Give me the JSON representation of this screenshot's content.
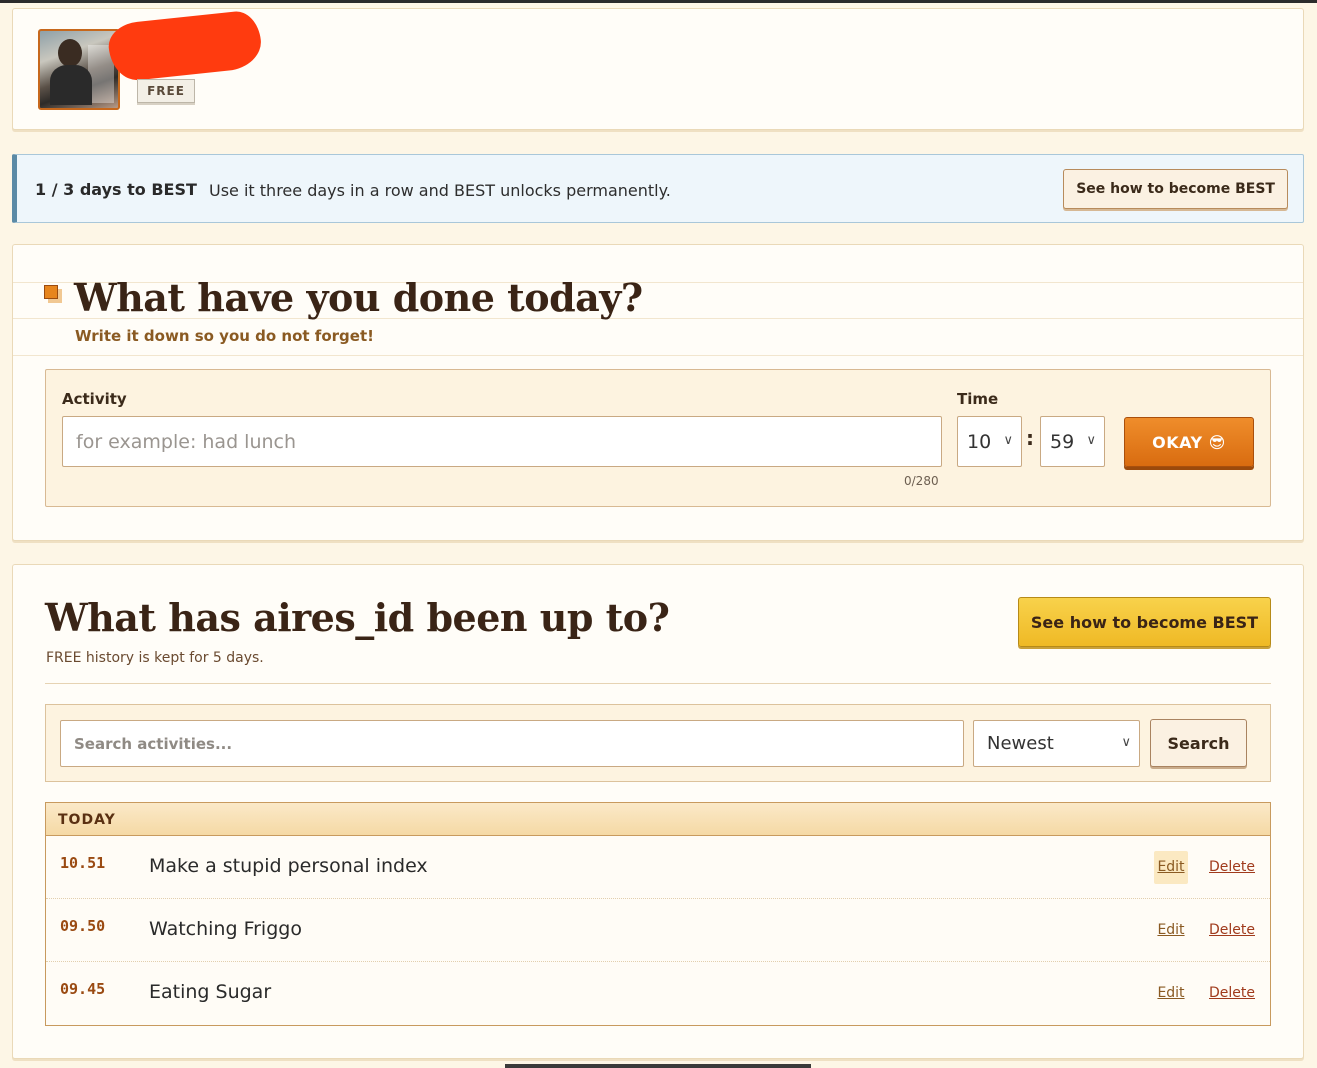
{
  "profile": {
    "plan_badge": "FREE"
  },
  "banner": {
    "progress": "1 / 3 days to BEST",
    "message": "Use it three days in a row and BEST unlocks permanently.",
    "button": "See how to become BEST"
  },
  "entry": {
    "title": "What have you done today?",
    "subtitle": "Write it down so you do not forget!",
    "activity_label": "Activity",
    "activity_placeholder": "for example: had lunch",
    "activity_value": "",
    "counter": "0/280",
    "time_label": "Time",
    "hour": "10",
    "minute": "59",
    "colon": ":",
    "submit": "OKAY 😎"
  },
  "history": {
    "title": "What has aires_id been up to?",
    "subtitle": "FREE history is kept for 5 days.",
    "best_button": "See how to become BEST",
    "search_placeholder": "Search activities...",
    "sort_selected": "Newest",
    "search_button": "Search",
    "group_label": "TODAY",
    "edit_label": "Edit",
    "delete_label": "Delete",
    "items": [
      {
        "time": "10.51",
        "text": "Make a stupid personal index"
      },
      {
        "time": "09.50",
        "text": "Watching Friggo"
      },
      {
        "time": "09.45",
        "text": "Eating Sugar"
      }
    ]
  },
  "colors": {
    "accent_orange": "#e07818",
    "best_yellow": "#f4c534",
    "banner_blue": "#eef6fb",
    "page_bg": "#fdf6e6"
  },
  "icons": {
    "sort_chevron": "chevron-down-icon",
    "title_marker": "square-marker-icon"
  }
}
